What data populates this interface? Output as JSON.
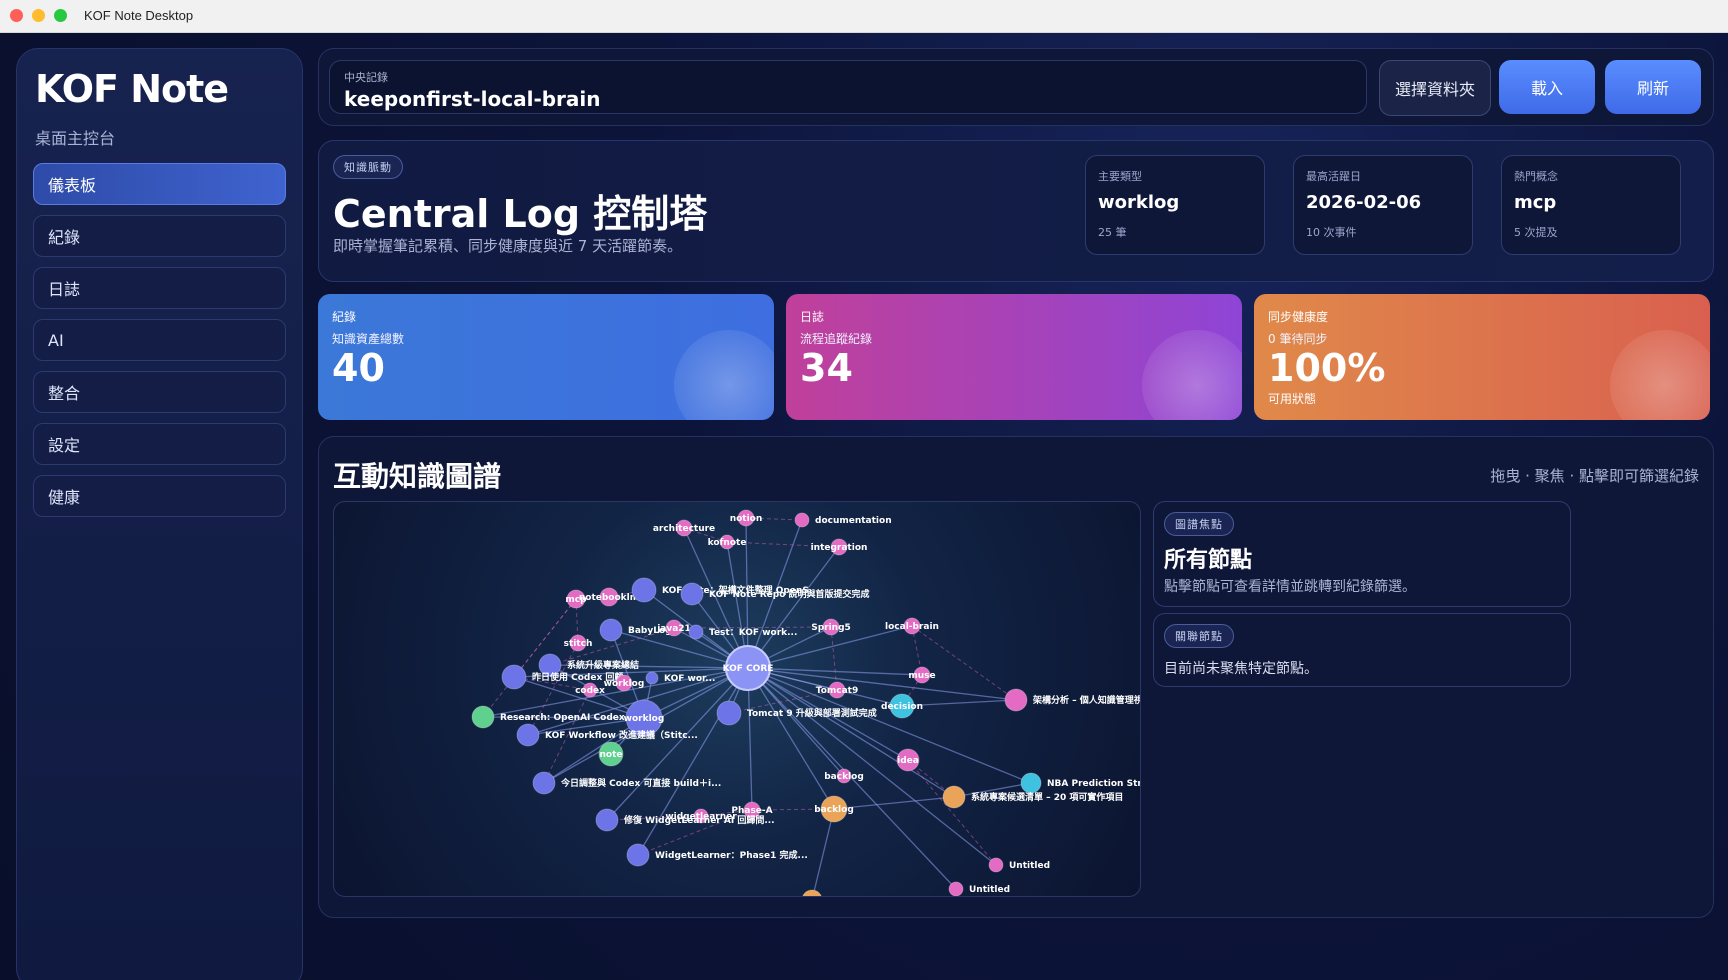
{
  "window": {
    "title": "KOF Note Desktop"
  },
  "sidebar": {
    "brand": "KOF Note",
    "subtitle": "桌面主控台",
    "items": [
      {
        "label": "儀表板",
        "active": true
      },
      {
        "label": "紀錄"
      },
      {
        "label": "日誌"
      },
      {
        "label": "AI"
      },
      {
        "label": "整合"
      },
      {
        "label": "設定"
      },
      {
        "label": "健康"
      }
    ]
  },
  "topbar": {
    "path_label": "中央記錄",
    "path_value": "keeponfirst-local-brain",
    "choose_folder": "選擇資料夾",
    "load": "載入",
    "refresh": "刷新"
  },
  "hero": {
    "chip": "知識脈動",
    "title": "Central Log 控制塔",
    "desc": "即時掌握筆記累積、同步健康度與近 7 天活躍節奏。",
    "stats": [
      {
        "label": "主要類型",
        "value": "worklog",
        "sub": "25 筆"
      },
      {
        "label": "最高活躍日",
        "value": "2026-02-06",
        "sub": "10 次事件"
      },
      {
        "label": "熱門概念",
        "value": "mcp",
        "sub": "5 次提及"
      }
    ]
  },
  "metrics": [
    {
      "label": "紀錄",
      "sub": "知識資產總數",
      "value": "40",
      "foot": ""
    },
    {
      "label": "日誌",
      "sub": "流程追蹤紀錄",
      "value": "34",
      "foot": ""
    },
    {
      "label": "同步健康度",
      "sub": "0 筆待同步",
      "value": "100%",
      "foot": "可用狀態"
    }
  ],
  "graph_panel": {
    "title": "互動知識圖譜",
    "hint": "拖曳 · 聚焦 · 點擊即可篩選紀錄",
    "focus_chip": "圖譜焦點",
    "focus_title": "所有節點",
    "focus_desc": "點擊節點可查看詳情並跳轉到紀錄篩選。",
    "related_chip": "關聯節點",
    "related_desc": "目前尚未聚焦特定節點。"
  },
  "colors": {
    "core": "#8b93f5",
    "record": "#6d74e8",
    "tag": "#e46bc4",
    "type_teal": "#3fc2e0",
    "type_green": "#5fd08e",
    "type_orange": "#e9a45a"
  },
  "graph": {
    "nodes": [
      {
        "id": "core",
        "label": "KOF CORE",
        "kind": "core"
      },
      {
        "id": "architecture",
        "label": "architecture",
        "kind": "tag"
      },
      {
        "id": "notion",
        "label": "notion",
        "kind": "tag"
      },
      {
        "id": "documentation",
        "label": "documentation",
        "kind": "tag"
      },
      {
        "id": "kofnote",
        "label": "kofnote",
        "kind": "tag"
      },
      {
        "id": "integration",
        "label": "integration",
        "kind": "tag"
      },
      {
        "id": "mcp",
        "label": "mcp",
        "kind": "tag"
      },
      {
        "id": "notebooklm",
        "label": "notebooklm",
        "kind": "tag"
      },
      {
        "id": "r_kof_note_a",
        "label": "KOF Note：架構文件整理 OpenS...",
        "kind": "record"
      },
      {
        "id": "r_kof_note_b",
        "label": "KOF Note Repo 說明與首版提交完成",
        "kind": "record"
      },
      {
        "id": "r_babylog",
        "label": "BabyLog",
        "kind": "record"
      },
      {
        "id": "java21",
        "label": "java21",
        "kind": "tag"
      },
      {
        "id": "r_first",
        "label": "Test：KOF work...",
        "kind": "record"
      },
      {
        "id": "spring5",
        "label": "Spring5",
        "kind": "tag"
      },
      {
        "id": "local-brain",
        "label": "local-brain",
        "kind": "tag"
      },
      {
        "id": "stitch",
        "label": "stitch",
        "kind": "tag"
      },
      {
        "id": "r_upgrade",
        "label": "系統升級專案總結",
        "kind": "record"
      },
      {
        "id": "r_codex",
        "label": "昨日使用 Codex 回顧",
        "kind": "record"
      },
      {
        "id": "worklog_tag",
        "label": "worklog",
        "kind": "tag"
      },
      {
        "id": "r_kof_wor",
        "label": "KOF wor...",
        "kind": "record"
      },
      {
        "id": "codex",
        "label": "codex",
        "kind": "tag"
      },
      {
        "id": "muse",
        "label": "muse",
        "kind": "tag"
      },
      {
        "id": "tomcat9",
        "label": "Tomcat9",
        "kind": "tag"
      },
      {
        "id": "decision",
        "label": "decision",
        "kind": "type_teal"
      },
      {
        "id": "r_arch",
        "label": "架構分析 – 個人知識管理視",
        "kind": "tag"
      },
      {
        "id": "r_research",
        "label": "Research: OpenAI Codex...",
        "kind": "type_green"
      },
      {
        "id": "worklog",
        "label": "worklog",
        "kind": "record"
      },
      {
        "id": "r_tomcat",
        "label": "Tomcat 9 升級與部署測試完成",
        "kind": "record"
      },
      {
        "id": "r_workflow",
        "label": "KOF Workflow 改進建議（Stitc...",
        "kind": "record"
      },
      {
        "id": "note",
        "label": "note",
        "kind": "type_green"
      },
      {
        "id": "idea",
        "label": "idea",
        "kind": "tag"
      },
      {
        "id": "r_today",
        "label": "今日調整與 Codex 可直接 build＋i...",
        "kind": "record"
      },
      {
        "id": "backlog_tag",
        "label": "backlog",
        "kind": "tag"
      },
      {
        "id": "r_nba",
        "label": "NBA Prediction Strateg",
        "kind": "type_teal"
      },
      {
        "id": "r_backlog_list",
        "label": "系統專案候選清單 – 20 項可實作項目",
        "kind": "type_orange"
      },
      {
        "id": "widgetlearner",
        "label": "widgetlearner",
        "kind": "tag"
      },
      {
        "id": "phase_a",
        "label": "Phase-A",
        "kind": "tag"
      },
      {
        "id": "backlog",
        "label": "backlog",
        "kind": "type_orange"
      },
      {
        "id": "r_widget_fix",
        "label": "修復 WidgetLearner AI 回歸問...",
        "kind": "record"
      },
      {
        "id": "r_widget_p1",
        "label": "WidgetLearner：Phase1 完成...",
        "kind": "record"
      },
      {
        "id": "untitled_1",
        "label": "Untitled",
        "kind": "tag"
      },
      {
        "id": "untitled_2",
        "label": "Untitled",
        "kind": "tag"
      },
      {
        "id": "r_bottom",
        "label": "",
        "kind": "type_orange"
      }
    ]
  }
}
